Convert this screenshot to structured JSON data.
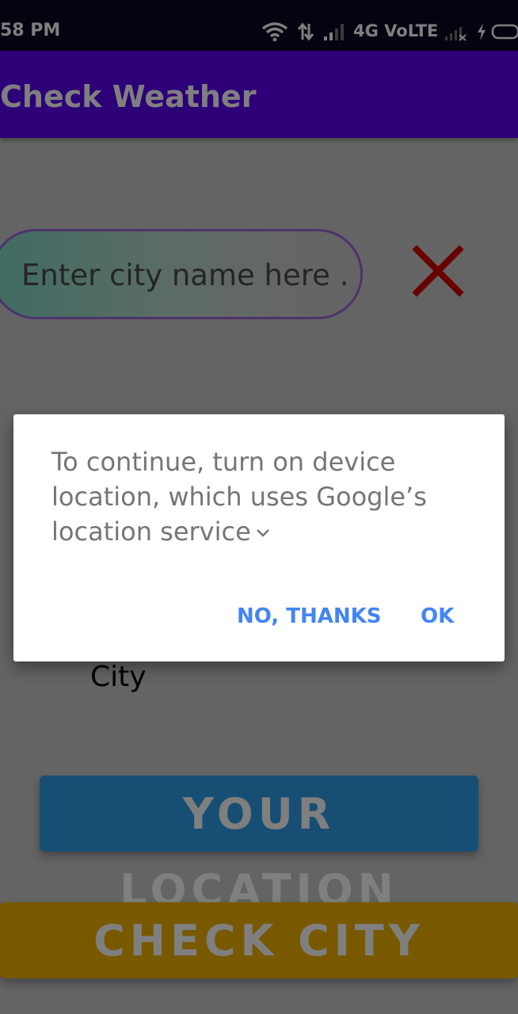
{
  "status_bar": {
    "time": "58 PM",
    "network": "4G VoLTE",
    "icons": [
      "wifi-icon",
      "data-transfer-icon",
      "signal-icon",
      "signal-no-sim-icon",
      "charging-icon",
      "battery-icon"
    ]
  },
  "app_bar": {
    "title": "Check Weather",
    "color": "#5a00f0"
  },
  "search": {
    "placeholder": "Enter city name here ...",
    "value": ""
  },
  "clear_icon": "close-icon",
  "city_label": "City",
  "buttons": {
    "your_location": "YOUR LOCATION",
    "check_city": "CHECK CITY"
  },
  "dialog": {
    "message": "To continue, turn on device location, which uses Google’s location service",
    "no_label": "NO, THANKS",
    "ok_label": "OK",
    "accent": "#4285f4"
  }
}
